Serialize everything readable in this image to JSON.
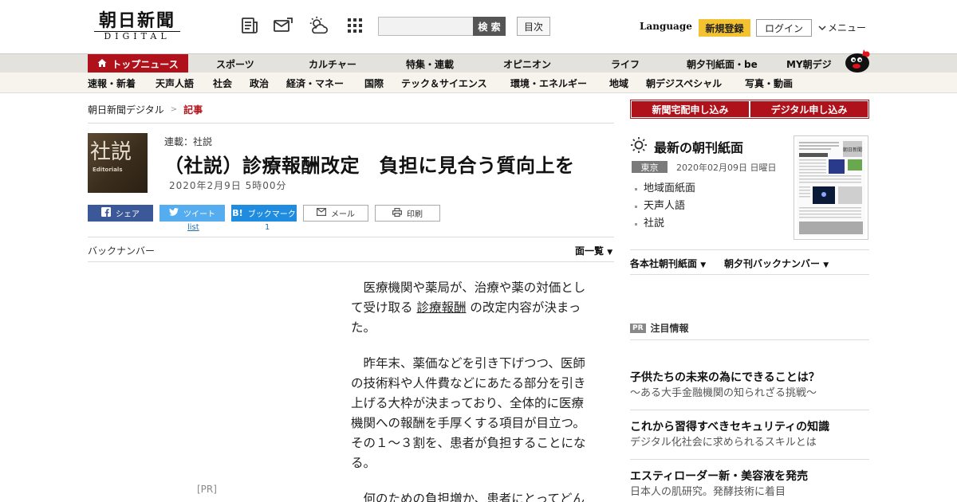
{
  "header": {
    "logo_kanji": "朝日新聞",
    "logo_digital": "DIGITAL",
    "search_button": "検 索",
    "contents_button": "目次",
    "language": "Language",
    "signup": "新規登録",
    "login": "ログイン",
    "menu": "メニュー"
  },
  "nav_primary": [
    "トップニュース",
    "スポーツ",
    "カルチャー",
    "特集・連載",
    "オピニオン",
    "ライフ",
    "朝夕刊紙面・be",
    "MY朝デジ"
  ],
  "nav_secondary": [
    "速報・新着",
    "天声人語",
    "社会",
    "政治",
    "経済・マネー",
    "国際",
    "テック＆サイエンス",
    "環境・エネルギー",
    "地域",
    "朝デジスペシャル",
    "写真・動画"
  ],
  "breadcrumb": {
    "home": "朝日新聞デジタル",
    "sep": ">",
    "current": "記事"
  },
  "article": {
    "image_big": "社説",
    "image_small": "Editorials",
    "series": "連載：社説",
    "headline": "（社説）診療報酬改定　負担に見合う質向上を",
    "date": "2020年2月9日 5時00分",
    "share": {
      "facebook": "シェア",
      "twitter": "ツイート",
      "twitter_count": "list",
      "hatena": "ブックマーク",
      "hatena_count": "1",
      "mail": "メール",
      "print": "印刷"
    },
    "back_number": "バックナンバー",
    "page_list": "面一覧",
    "p1_before": "　医療機関や薬局が、治療や薬の対価として受け取る ",
    "p1_link": "診療報酬",
    "p1_after": " の改定内容が決まった。",
    "p2": "　昨年末、薬価などを引き下げつつ、医師の技術料や人件費などにあたる部分を引き上げる大枠が決まっており、全体的に医療機関への報酬を手厚くする項目が目立つ。その１～３割を、患者が負担することになる。",
    "p3": "　何のための負担増か、患者にとってどん",
    "ad_label": "[PR]"
  },
  "sidebar": {
    "subscribe_home": "新聞宅配申し込み",
    "subscribe_digital": "デジタル申し込み",
    "paper_title": "最新の朝刊紙面",
    "edition": "東京",
    "paper_date": "2020年02月09日 日曜日",
    "paper_links": [
      "地域面紙面",
      "天声人語",
      "社説"
    ],
    "dropdown_regional": "各本社朝刊紙面",
    "dropdown_back": "朝夕刊バックナンバー",
    "pr_badge": "PR",
    "pr_heading": "注目情報",
    "pr_items": [
      {
        "title": "子供たちの未来の為にできることは？",
        "sub": "～ある大手金融機関の知られざる挑戦～"
      },
      {
        "title": "これから習得すべきセキュリティの知識",
        "sub": "デジタル化社会に求められるスキルとは"
      },
      {
        "title": "エスティローダー新・美容液を発売",
        "sub": "日本人の肌研究。発酵技術に着目"
      }
    ]
  },
  "colors": {
    "brand_red": "#b0121b",
    "signup_yellow": "#f2c230",
    "facebook": "#3b5998",
    "twitter": "#55acee",
    "hatena": "#1f8ce0"
  }
}
